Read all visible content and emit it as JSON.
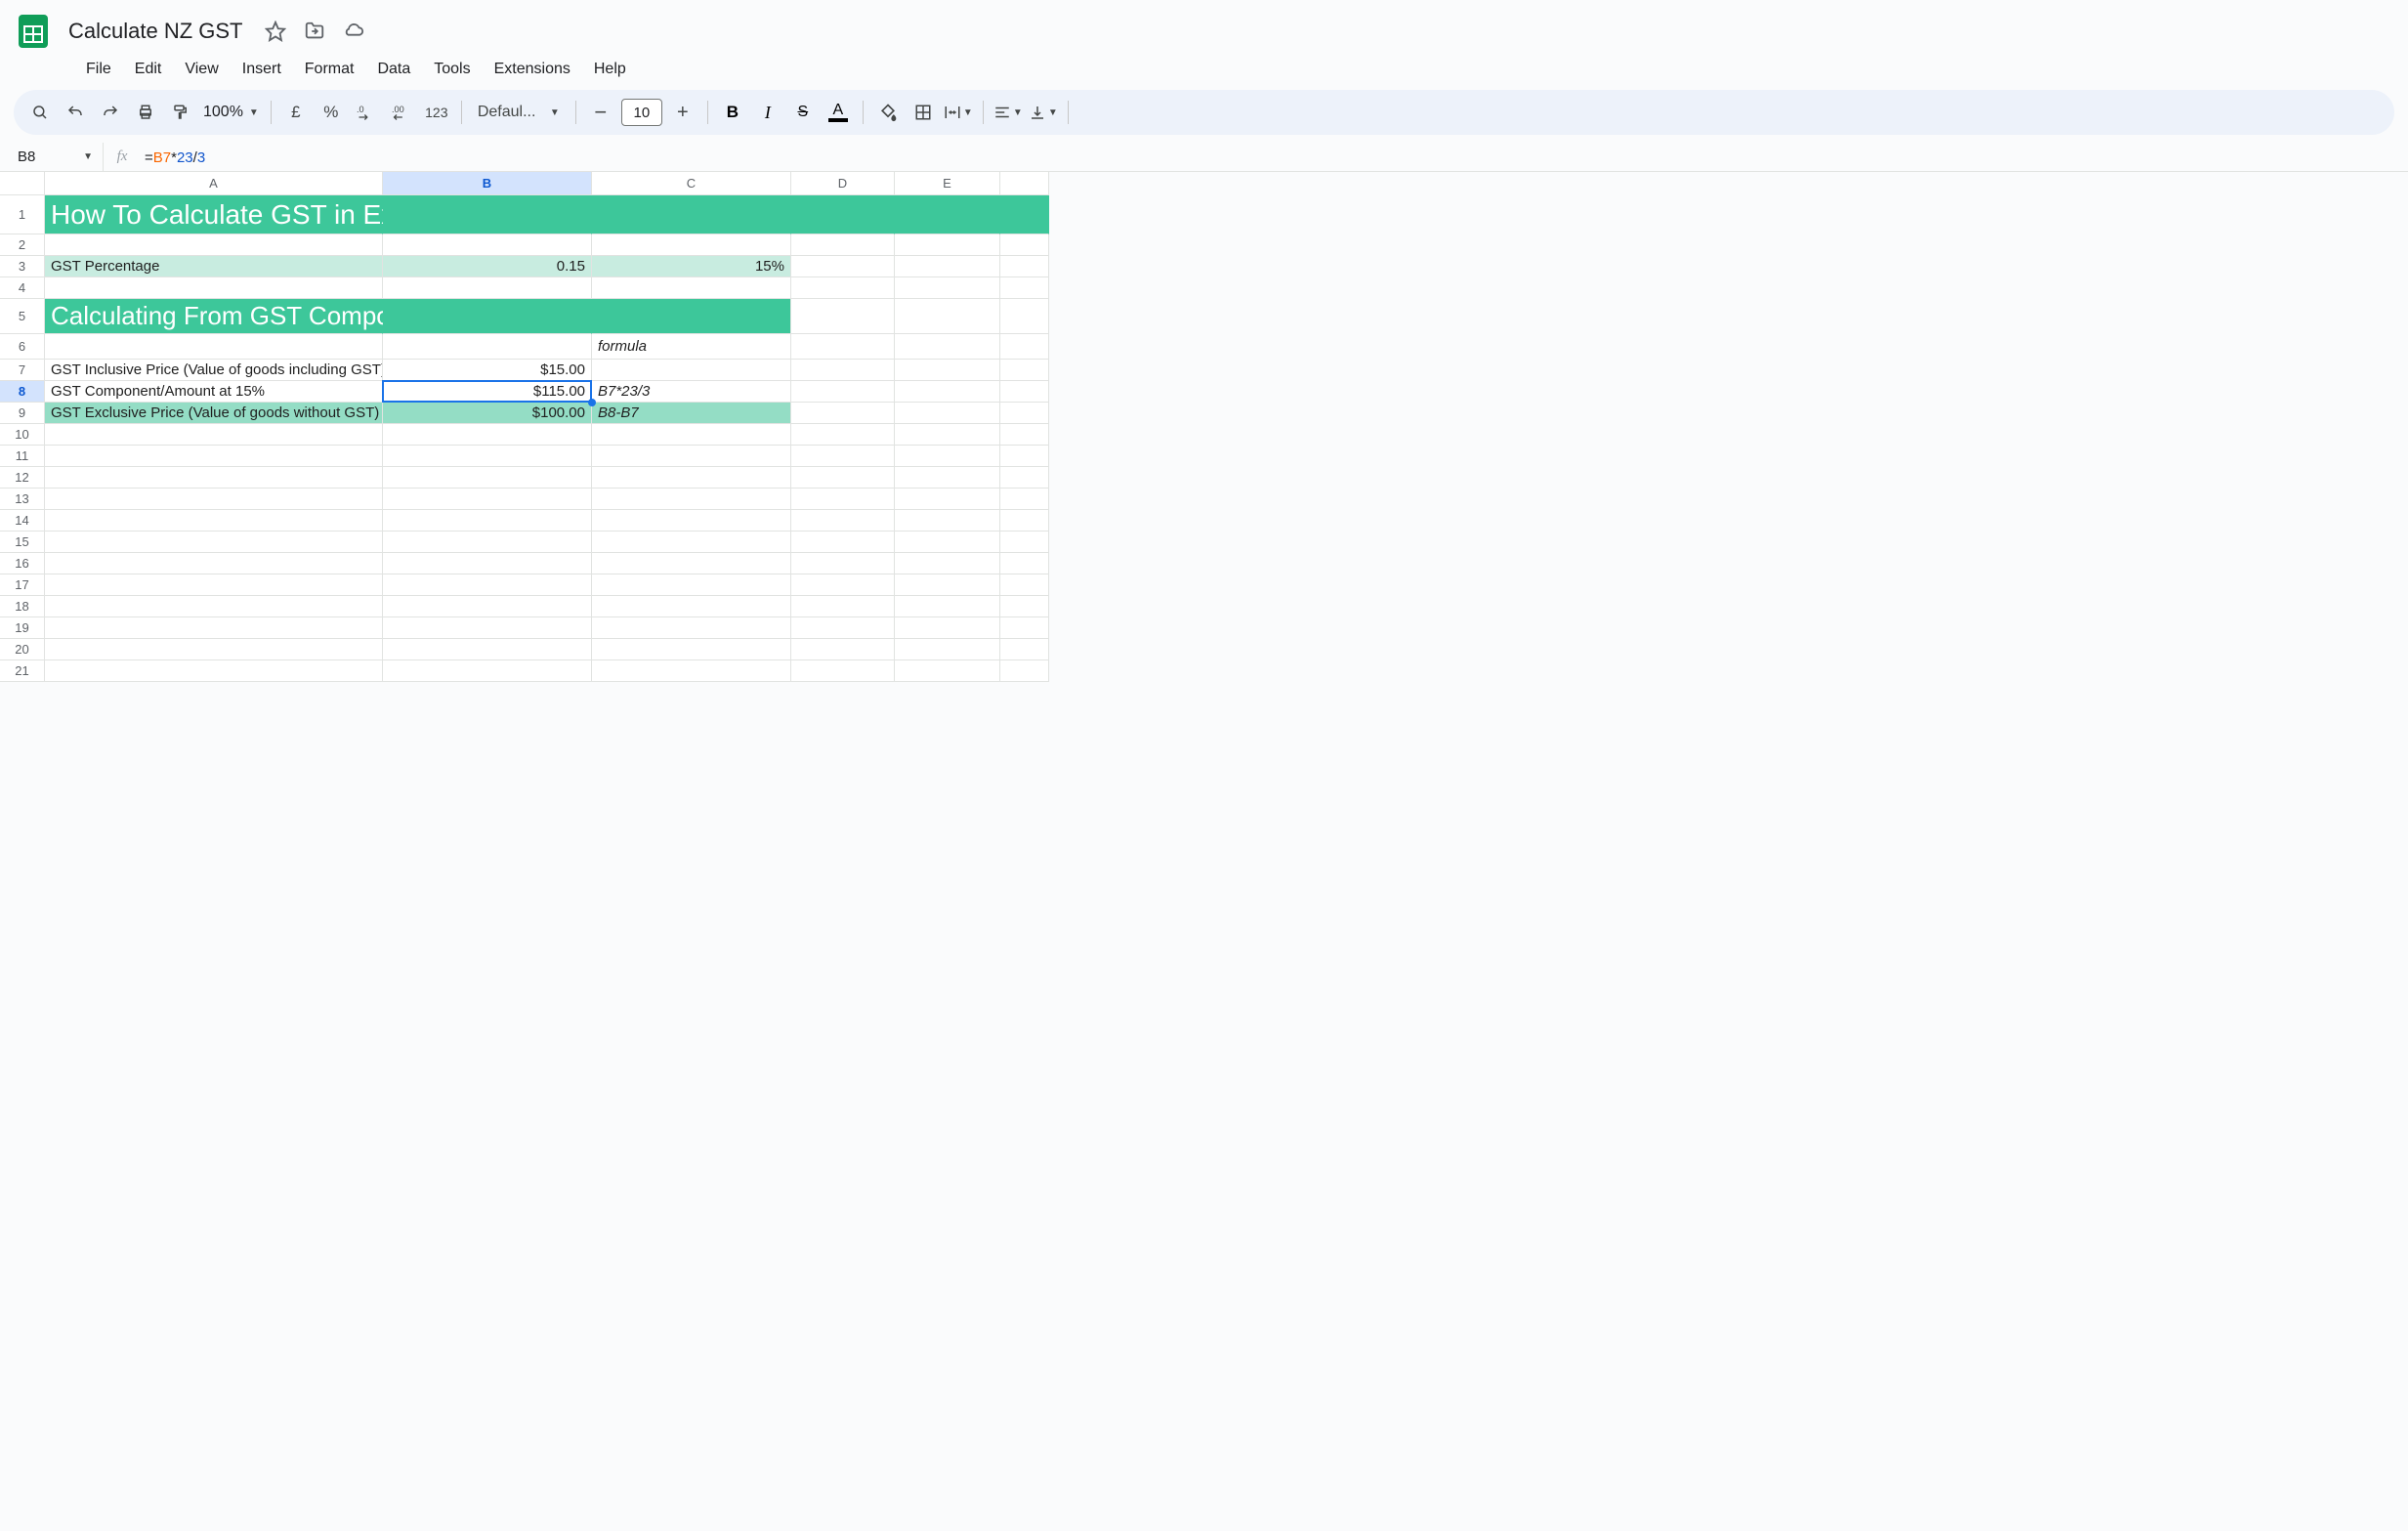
{
  "doc": {
    "title": "Calculate NZ GST"
  },
  "menu": {
    "file": "File",
    "edit": "Edit",
    "view": "View",
    "insert": "Insert",
    "format": "Format",
    "data": "Data",
    "tools": "Tools",
    "extensions": "Extensions",
    "help": "Help"
  },
  "toolbar": {
    "zoom": "100%",
    "currency_symbol": "£",
    "percent": "%",
    "one23": "123",
    "font": "Defaul...",
    "font_size": "10",
    "bold": "B",
    "italic": "I"
  },
  "name_box": {
    "ref": "B8"
  },
  "formula": {
    "eq": "=",
    "cell": "B7",
    "op1": "*",
    "n1": "23",
    "op2": "/",
    "n2": "3"
  },
  "columns": {
    "A": "A",
    "B": "B",
    "C": "C",
    "D": "D",
    "E": "E"
  },
  "row_heights": {
    "r1": 40,
    "r5": 36,
    "r6": 26,
    "default": 22
  },
  "sheet": {
    "r1": {
      "A": "How To Calculate GST in Excel"
    },
    "r3": {
      "A": "GST Percentage",
      "B": "0.15",
      "C": "15%"
    },
    "r5": {
      "A": "Calculating From GST Component/Amount"
    },
    "r6": {
      "C": "formula"
    },
    "r7": {
      "A": "GST Inclusive Price (Value of goods including GST)",
      "B": "$15.00"
    },
    "r8": {
      "A": "GST Component/Amount at 15%",
      "B": "$115.00",
      "C": "B7*23/3"
    },
    "r9": {
      "A": "GST Exclusive Price (Value of goods without GST)",
      "B": "$100.00",
      "C": "B8-B7"
    }
  },
  "colors": {
    "header_green": "#3dc79a",
    "light_green": "#c8ece0",
    "mid_green": "#94ddc5"
  },
  "chart_data": null
}
